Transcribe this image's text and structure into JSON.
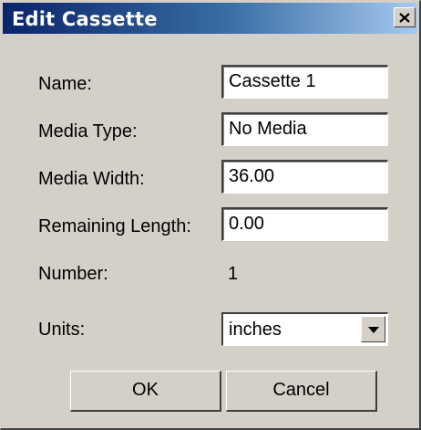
{
  "dialog": {
    "title": "Edit Cassette"
  },
  "fields": {
    "name_label": "Name:",
    "name_value": "Cassette 1",
    "media_type_label": "Media Type:",
    "media_type_value": "No Media",
    "media_width_label": "Media Width:",
    "media_width_value": "36.00",
    "remaining_length_label": "Remaining Length:",
    "remaining_length_value": "0.00",
    "number_label": "Number:",
    "number_value": "1",
    "units_label": "Units:",
    "units_value": "inches"
  },
  "buttons": {
    "ok_label": "OK",
    "cancel_label": "Cancel"
  },
  "icons": {
    "close": "close-icon",
    "dropdown": "chevron-down-icon"
  },
  "colors": {
    "face": "#d4d0c8",
    "title_start": "#0a246a",
    "title_end": "#a6caf0"
  }
}
